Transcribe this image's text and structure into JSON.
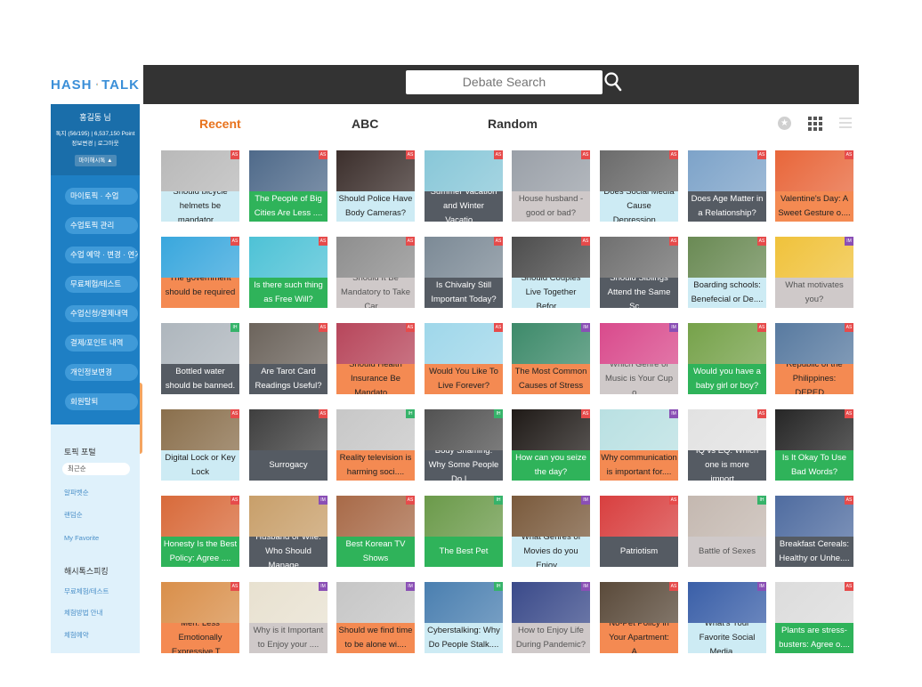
{
  "logo": {
    "text_left": "HASH",
    "text_right": "TALK"
  },
  "search": {
    "placeholder": "Debate Search"
  },
  "profile": {
    "name": "홍길동 님",
    "stats": "톡지 (56/195) | 6,537,150 Point",
    "links": "정보변경 | 로그아웃",
    "mypage": "마이해시톡 ▲"
  },
  "menu": [
    "마이토픽 · 수업",
    "수업토픽 관리",
    "수업 예약 · 변경 · 연기",
    "무료체험/테스트",
    "수업신청/결제내역",
    "결제/포인트 내역",
    "개인정보변경",
    "회원탈퇴"
  ],
  "portal": {
    "title": "토픽 포털",
    "items": [
      "최근순",
      "알파벳순",
      "랜덤순",
      "My Favorite"
    ],
    "section2_title": "해시톡스피킹",
    "section2_items": [
      "무료체험/테스트",
      "체험방법 안내",
      "체험예약"
    ]
  },
  "tabs": [
    "Recent",
    "ABC",
    "Random"
  ],
  "colors": {
    "dark": "#555b63",
    "green": "#2fb35a",
    "orange": "#f48a52",
    "cyan": "#cdebf4",
    "gray": "#cfc9c9",
    "badge_red": "#e64b4b",
    "badge_green": "#36b36a",
    "badge_purple": "#8a4fb5"
  },
  "cards": [
    [
      {
        "title": "Should bicycle helmets be mandator....",
        "style": "cyan",
        "badge": "AS",
        "badge_color": "red",
        "img": "#b9b9b9"
      },
      {
        "title": "The People of Big Cities Are Less ....",
        "style": "green",
        "badge": "AS",
        "badge_color": "red",
        "img": "#4f6a8a"
      },
      {
        "title": "Should Police Have Body Cameras?",
        "style": "cyan",
        "badge": "AS",
        "badge_color": "red",
        "img": "#3c2f2c"
      },
      {
        "title": "Summer Vacation and Winter Vacatio....",
        "style": "dark",
        "badge": "AS",
        "badge_color": "red",
        "img": "#88c7d8"
      },
      {
        "title": "House husband - good or bad?",
        "style": "gray",
        "badge": "AS",
        "badge_color": "red",
        "img": "#9aa0a8"
      },
      {
        "title": "Does Social Media Cause Depression....",
        "style": "cyan",
        "badge": "AS",
        "badge_color": "red",
        "img": "#6b6b6b"
      },
      {
        "title": "Does Age Matter in a Relationship?",
        "style": "dark",
        "badge": "AS",
        "badge_color": "red",
        "img": "#7da3c9"
      },
      {
        "title": "Valentine's Day: A Sweet Gesture o....",
        "style": "orange",
        "badge": "AS",
        "badge_color": "red",
        "img": "#e8663a"
      }
    ],
    [
      {
        "title": "The government should be required ....",
        "style": "orange",
        "badge": "AS",
        "badge_color": "red",
        "img": "#39a7dd"
      },
      {
        "title": "Is there such thing as Free Will?",
        "style": "green",
        "badge": "AS",
        "badge_color": "red",
        "img": "#4ec2d6"
      },
      {
        "title": "Should It Be Mandatory to Take Car....",
        "style": "gray",
        "badge": "AS",
        "badge_color": "red",
        "img": "#8e8e8e"
      },
      {
        "title": "Is Chivalry Still Important Today?",
        "style": "dark",
        "badge": "AS",
        "badge_color": "red",
        "img": "#7c8a96"
      },
      {
        "title": "Should Couples Live Together Befor....",
        "style": "cyan",
        "badge": "AS",
        "badge_color": "red",
        "img": "#4d4d4d"
      },
      {
        "title": "Should Siblings Attend the Same Sc....",
        "style": "dark",
        "badge": "AS",
        "badge_color": "red",
        "img": "#707070"
      },
      {
        "title": "Boarding schools: Benefecial or De....",
        "style": "cyan",
        "badge": "AS",
        "badge_color": "red",
        "img": "#6a8a54"
      },
      {
        "title": "What motivates you?",
        "style": "gray",
        "badge": "IM",
        "badge_color": "purple",
        "img": "#f0c23b"
      }
    ],
    [
      {
        "title": "Bottled water should be banned.",
        "style": "dark",
        "badge": "IH",
        "badge_color": "green",
        "img": "#aeb6bd"
      },
      {
        "title": "Are Tarot Card Readings Useful?",
        "style": "dark",
        "badge": "AS",
        "badge_color": "red",
        "img": "#6c645c"
      },
      {
        "title": "Should Health Insurance Be Mandato....",
        "style": "orange",
        "badge": "AS",
        "badge_color": "red",
        "img": "#b7465b"
      },
      {
        "title": "Would You Like To Live Forever?",
        "style": "orange",
        "badge": "AS",
        "badge_color": "red",
        "img": "#9fd7ea"
      },
      {
        "title": "The Most Common Causes of Stress",
        "style": "orange",
        "badge": "IM",
        "badge_color": "purple",
        "img": "#3d8a6a"
      },
      {
        "title": "Which Genre of Music is Your Cup o....",
        "style": "gray",
        "badge": "IM",
        "badge_color": "purple",
        "img": "#d94a8c"
      },
      {
        "title": "Would you have a baby girl or boy?",
        "style": "green",
        "badge": "AS",
        "badge_color": "red",
        "img": "#76a24a"
      },
      {
        "title": "Republic of the Philippines: DEPED....",
        "style": "orange",
        "badge": "AS",
        "badge_color": "red",
        "img": "#587aa0"
      }
    ],
    [
      {
        "title": "Digital Lock or Key Lock",
        "style": "cyan",
        "badge": "AS",
        "badge_color": "red",
        "img": "#8a6f4c"
      },
      {
        "title": "Surrogacy",
        "style": "dark",
        "badge": "AS",
        "badge_color": "red",
        "img": "#3f3f3f"
      },
      {
        "title": "Reality television is harming soci....",
        "style": "orange",
        "badge": "IH",
        "badge_color": "green",
        "img": "#c7c7c7"
      },
      {
        "title": "Body Shaming: Why Some People Do I....",
        "style": "dark",
        "badge": "IH",
        "badge_color": "green",
        "img": "#525252"
      },
      {
        "title": "How can you seize the day?",
        "style": "green",
        "badge": "AS",
        "badge_color": "red",
        "img": "#1f1a17"
      },
      {
        "title": "Why communication is important for....",
        "style": "orange",
        "badge": "IM",
        "badge_color": "purple",
        "img": "#b9e0e2"
      },
      {
        "title": "IQ vs EQ: Which one is more import....",
        "style": "dark",
        "badge": "AS",
        "badge_color": "red",
        "img": "#e2e2e2"
      },
      {
        "title": "Is It Okay To Use Bad Words?",
        "style": "green",
        "badge": "AS",
        "badge_color": "red",
        "img": "#262626"
      }
    ],
    [
      {
        "title": "Honesty Is the Best Policy: Agree ....",
        "style": "green",
        "badge": "AS",
        "badge_color": "red",
        "img": "#d86a3a"
      },
      {
        "title": "Husband or Wife: Who Should Manage....",
        "style": "dark",
        "badge": "IM",
        "badge_color": "purple",
        "img": "#c89f6a"
      },
      {
        "title": "Best Korean TV Shows",
        "style": "green",
        "badge": "AS",
        "badge_color": "red",
        "img": "#a86a48"
      },
      {
        "title": "The Best Pet",
        "style": "green",
        "badge": "IH",
        "badge_color": "green",
        "img": "#6b9a4a"
      },
      {
        "title": "What Genres of Movies do you Enjoy....",
        "style": "cyan",
        "badge": "IM",
        "badge_color": "purple",
        "img": "#7a5a3c"
      },
      {
        "title": "Patriotism",
        "style": "dark",
        "badge": "AS",
        "badge_color": "red",
        "img": "#d83f3f"
      },
      {
        "title": "Battle of Sexes",
        "style": "gray",
        "badge": "IH",
        "badge_color": "green",
        "img": "#c4b8b0"
      },
      {
        "title": "Breakfast Cereals: Healthy or Unhe....",
        "style": "dark",
        "badge": "AS",
        "badge_color": "red",
        "img": "#4f6ca0"
      }
    ],
    [
      {
        "title": "Men: Less Emotionally Expressive T....",
        "style": "orange",
        "badge": "AS",
        "badge_color": "red",
        "img": "#d98f4a"
      },
      {
        "title": "Why is it Important to Enjoy your ....",
        "style": "gray",
        "badge": "IM",
        "badge_color": "purple",
        "img": "#e8e1d0"
      },
      {
        "title": "Should we find time to be alone wi....",
        "style": "orange",
        "badge": "IM",
        "badge_color": "purple",
        "img": "#c6c6c6"
      },
      {
        "title": "Cyberstalking: Why Do People Stalk....",
        "style": "cyan",
        "badge": "IH",
        "badge_color": "green",
        "img": "#4a7fb0"
      },
      {
        "title": "How to Enjoy Life During Pandemic?",
        "style": "gray",
        "badge": "IM",
        "badge_color": "purple",
        "img": "#3a4a8a"
      },
      {
        "title": "No-Pet Policy in Your Apartment: A....",
        "style": "orange",
        "badge": "AS",
        "badge_color": "red",
        "img": "#5a4a3a"
      },
      {
        "title": "What's Your Favorite Social Media ....",
        "style": "cyan",
        "badge": "IM",
        "badge_color": "purple",
        "img": "#3a5fa8"
      },
      {
        "title": "Plants are stress-busters: Agree o....",
        "style": "green",
        "badge": "AS",
        "badge_color": "red",
        "img": "#dcdcdc"
      }
    ]
  ]
}
